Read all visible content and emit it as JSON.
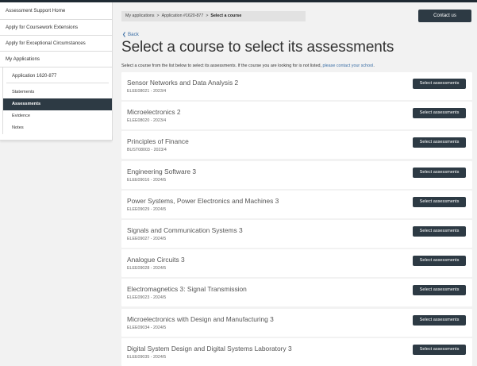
{
  "sidebar": {
    "links": [
      {
        "name": "sidebar-link-assessment-support-home",
        "label": "Assessment Support Home"
      },
      {
        "name": "sidebar-link-coursework-extensions",
        "label": "Apply for Coursework Extensions"
      },
      {
        "name": "sidebar-link-exceptional-circumstances",
        "label": "Apply for Exceptional Circumstances"
      },
      {
        "name": "sidebar-link-my-applications",
        "label": "My Applications"
      }
    ],
    "application_label": "Application 1620-877",
    "sub_items": [
      {
        "name": "sidebar-item-statements",
        "label": "Statements",
        "active": false
      },
      {
        "name": "sidebar-item-assessments",
        "label": "Assessments",
        "active": true
      },
      {
        "name": "sidebar-item-evidence",
        "label": "Evidence",
        "active": false
      },
      {
        "name": "sidebar-item-notes",
        "label": "Notes",
        "active": false
      }
    ]
  },
  "breadcrumb": {
    "items": [
      "My applications",
      "Application #1620-877"
    ],
    "current": "Select a course",
    "separator": ">"
  },
  "header": {
    "contact_label": "Contact us"
  },
  "main": {
    "back_label": "Back",
    "title": "Select a course to select its assessments",
    "intro_text": "Select a course from the list below to select its assessments. If the course you are looking for is not listed, ",
    "intro_link": "please contact your school",
    "intro_end": ".",
    "select_label": "Select assessments",
    "courses": [
      {
        "name": "Sensor Networks and Data Analysis 2",
        "meta": "ELEE08021 - 2023/4"
      },
      {
        "name": "Microelectronics 2",
        "meta": "ELEE08020 - 2023/4"
      },
      {
        "name": "Principles of Finance",
        "meta": "BUST08003 - 2023/4"
      },
      {
        "name": "Engineering Software 3",
        "meta": "ELEE09016 - 2024/5"
      },
      {
        "name": "Power Systems, Power Electronics and Machines 3",
        "meta": "ELEE09029 - 2024/5"
      },
      {
        "name": "Signals and Communication Systems 3",
        "meta": "ELEE09027 - 2024/5"
      },
      {
        "name": "Analogue Circuits 3",
        "meta": "ELEE09028 - 2024/5"
      },
      {
        "name": "Electromagnetics 3: Signal Transmission",
        "meta": "ELEE09023 - 2024/5"
      },
      {
        "name": "Microelectronics with Design and Manufacturing 3",
        "meta": "ELEE09034 - 2024/5"
      },
      {
        "name": "Digital System Design and Digital Systems Laboratory 3",
        "meta": "ELEE09035 - 2024/5"
      }
    ]
  },
  "colors": {
    "dark": "#2d3a44",
    "link": "#3a6ea5",
    "background": "#f2f2f2"
  }
}
